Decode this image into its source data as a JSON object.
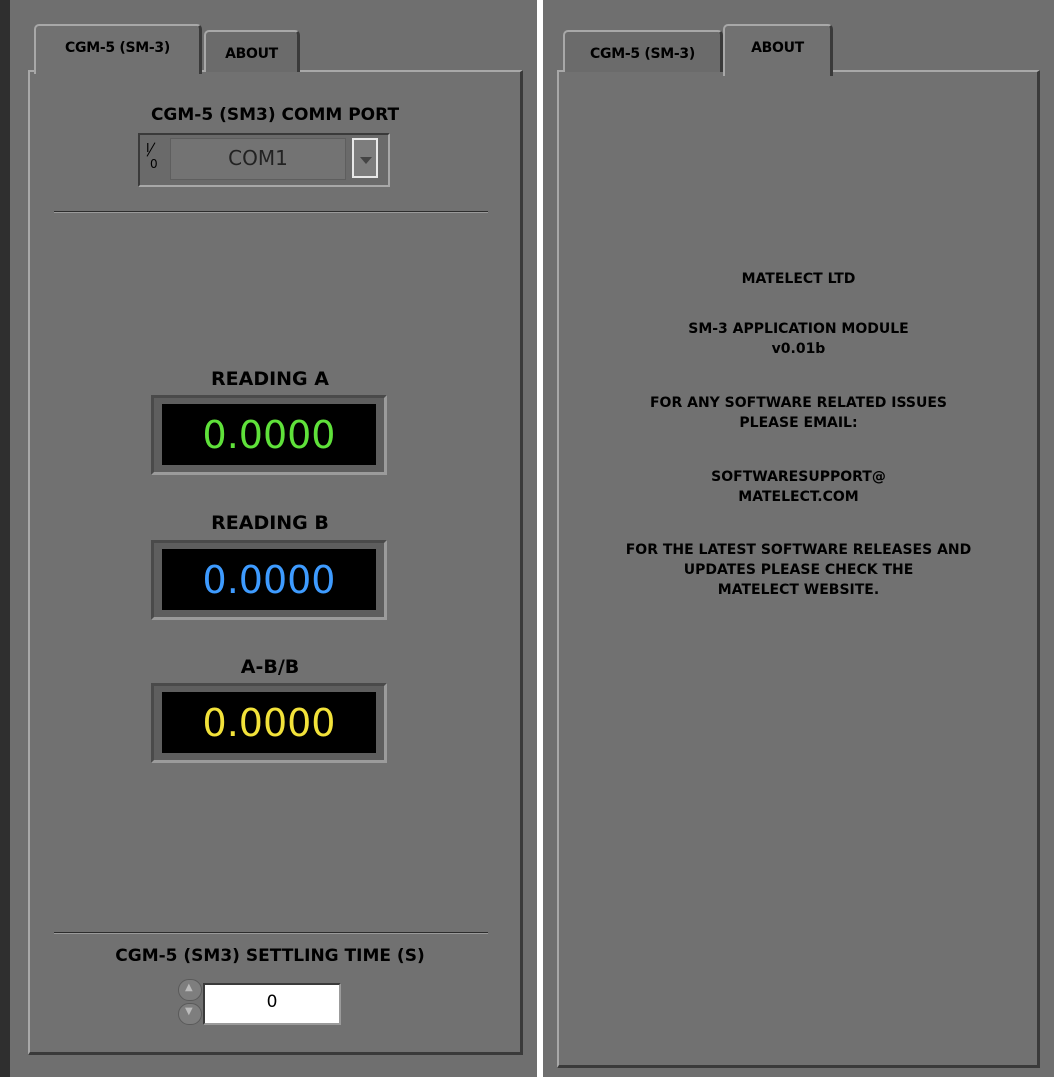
{
  "left_panel": {
    "tabs": [
      {
        "label": "CGM-5 (SM-3)",
        "active": true
      },
      {
        "label": "ABOUT",
        "active": false
      }
    ],
    "comm_port": {
      "label": "CGM-5 (SM3) COMM PORT",
      "io_glyph": "I/O",
      "value": "COM1"
    },
    "readings": [
      {
        "label": "READING A",
        "value": "0.0000",
        "color": "#5fe13a"
      },
      {
        "label": "READING B",
        "value": "0.0000",
        "color": "#3e9bff"
      },
      {
        "label": "A-B/B",
        "value": "0.0000",
        "color": "#f2e23a"
      }
    ],
    "settling": {
      "label": "CGM-5 (SM3) SETTLING TIME (S)",
      "value": "0"
    }
  },
  "right_panel": {
    "tabs": [
      {
        "label": "CGM-5 (SM-3)",
        "active": false
      },
      {
        "label": "ABOUT",
        "active": true
      }
    ],
    "about": {
      "company": "MATELECT LTD",
      "module_name": "SM-3 APPLICATION MODULE",
      "version": "v0.01b",
      "support_line1": "FOR ANY SOFTWARE RELATED ISSUES",
      "support_line2": "PLEASE EMAIL:",
      "email_line1": "SOFTWARESUPPORT@",
      "email_line2": "MATELECT.COM",
      "updates_line1": "FOR THE LATEST SOFTWARE RELEASES AND",
      "updates_line2": "UPDATES PLEASE CHECK THE",
      "updates_line3": "MATELECT WEBSITE."
    }
  }
}
